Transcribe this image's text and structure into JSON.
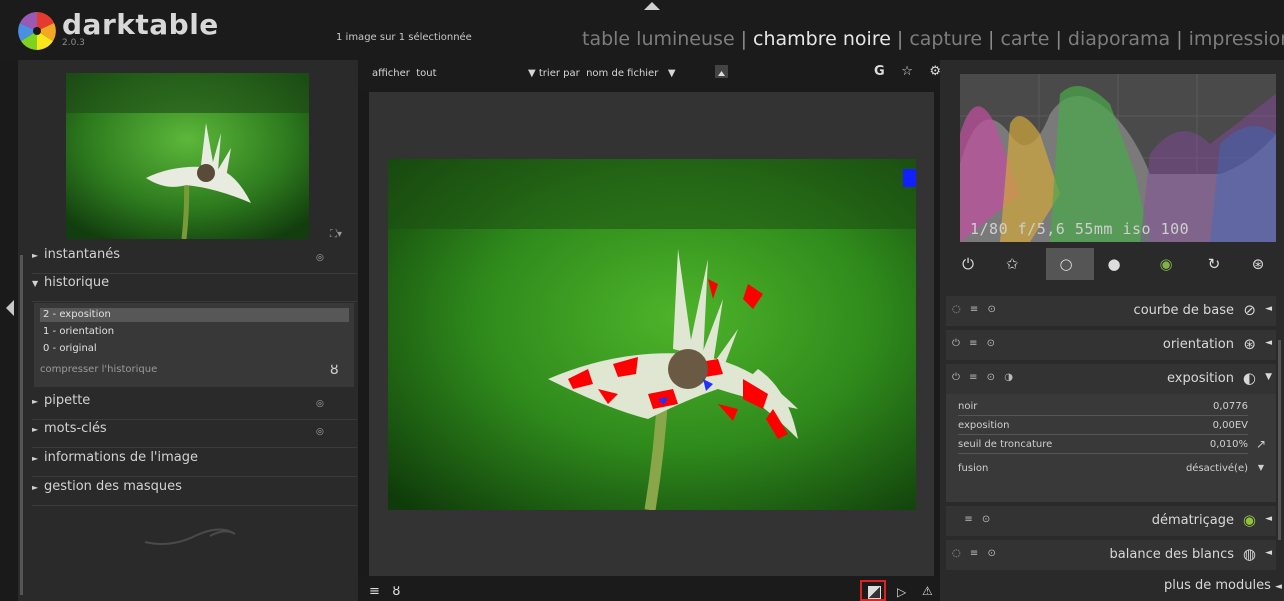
{
  "app": {
    "name": "darktable",
    "version": "2.0.3"
  },
  "header": {
    "selection": "1 image sur 1 sélectionnée",
    "views": [
      "table lumineuse",
      "chambre noire",
      "capture",
      "carte",
      "diaporama",
      "impression"
    ],
    "active_view": "chambre noire"
  },
  "left": {
    "panels": [
      "instantanés",
      "historique",
      "pipette",
      "mots-clés",
      "informations de l'image",
      "gestion des masques"
    ],
    "history": [
      "2 - exposition",
      "1 - orientation",
      "0 - original"
    ],
    "compress": "compresser l'historique"
  },
  "toolbar": {
    "show_label": "afficher",
    "show_value": "tout",
    "sort_label": "trier par",
    "sort_value": "nom de fichier",
    "icons": "G ☆ ⚙"
  },
  "right": {
    "exif": "1/80 f/5,6 55mm iso 100",
    "modules": {
      "base_curve": "courbe de base",
      "orientation": "orientation",
      "exposure": "exposition",
      "demosaic": "dématriçage",
      "white_balance": "balance des blancs"
    },
    "exposure_params": [
      {
        "label": "noir",
        "value": "0,0776"
      },
      {
        "label": "exposition",
        "value": "0,00EV"
      },
      {
        "label": "seuil de troncature",
        "value": "0,010%"
      }
    ],
    "blend_label": "fusion",
    "blend_value": "désactivé(e)",
    "more_modules": "plus de modules"
  },
  "colors": {
    "accent": "#d22222",
    "panel": "#2a2a2a",
    "clipping": "#ff0000"
  }
}
